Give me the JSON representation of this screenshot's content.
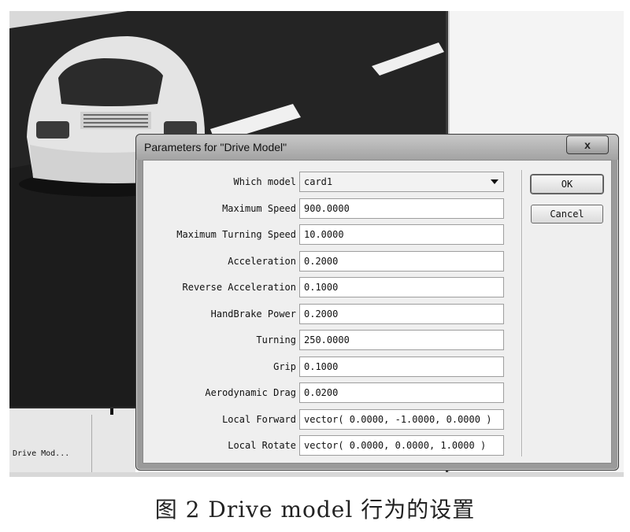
{
  "dialog": {
    "title": "Parameters for \"Drive Model\"",
    "close_glyph": "x",
    "ok_label": "OK",
    "cancel_label": "Cancel",
    "fields": [
      {
        "label": "Which model",
        "value": "card1",
        "type": "select"
      },
      {
        "label": "Maximum Speed",
        "value": "900.0000"
      },
      {
        "label": "Maximum Turning Speed",
        "value": "10.0000"
      },
      {
        "label": "Acceleration",
        "value": "0.2000"
      },
      {
        "label": "Reverse Acceleration",
        "value": "0.1000"
      },
      {
        "label": "HandBrake Power",
        "value": "0.2000"
      },
      {
        "label": "Turning",
        "value": "250.0000"
      },
      {
        "label": "Grip",
        "value": "0.1000"
      },
      {
        "label": "Aerodynamic Drag",
        "value": "0.0200"
      },
      {
        "label": "Local Forward",
        "value": "vector( 0.0000, -1.0000, 0.0000 )"
      },
      {
        "label": "Local Rotate",
        "value": "vector( 0.0000, 0.0000, 1.0000 )"
      }
    ]
  },
  "bottom_panel": {
    "item_label": "Drive Mod..."
  },
  "caption": "图 2   Drive model 行为的设置",
  "colors": {
    "viewport_bg": "#202020",
    "car_body": "#e6e6e6",
    "road_marking": "#f2f2f2",
    "dialog_frame": "#9a9a9a",
    "dialog_client": "#efefef"
  }
}
